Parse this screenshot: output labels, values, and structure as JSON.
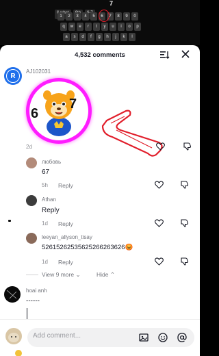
{
  "keyboard": {
    "suggestions": [
      "6.what",
      "6th",
      "6-7"
    ],
    "row1": [
      "1",
      "2",
      "3",
      "4",
      "5",
      "6",
      "7",
      "8",
      "9",
      "0"
    ],
    "row2": [
      "q",
      "w",
      "e",
      "r",
      "t",
      "y",
      "u",
      "i",
      "o",
      "p"
    ],
    "row3": [
      "a",
      "s",
      "d",
      "f",
      "g",
      "h",
      "j",
      "k",
      "l"
    ],
    "caption": "7"
  },
  "header": {
    "comment_count": "4,532 comments"
  },
  "comments": [
    {
      "username": "AJ102031",
      "avatar_letter": "R",
      "time": "2d",
      "sticker_numbers": [
        "6",
        "7"
      ]
    },
    {
      "username": "любовь",
      "text": "67",
      "time": "5h",
      "reply": "Reply"
    },
    {
      "username": "Athan",
      "text": "Reply",
      "time": "1d",
      "reply": "Reply"
    },
    {
      "username": "leeyan_allyson_tisay",
      "text": "52615262535625266263626",
      "time": "1d",
      "reply": "Reply",
      "emoji": "😡"
    },
    {
      "username": "hoai anh",
      "text": "------"
    }
  ],
  "thread_controls": {
    "view_more": "View 9 more",
    "hide": "Hide"
  },
  "composer": {
    "placeholder": "Add comment..."
  },
  "colors": {
    "accent_magenta": "#ff1cff",
    "annotation_red": "#e11d2a",
    "avatar_blue": "#1f6feb"
  }
}
